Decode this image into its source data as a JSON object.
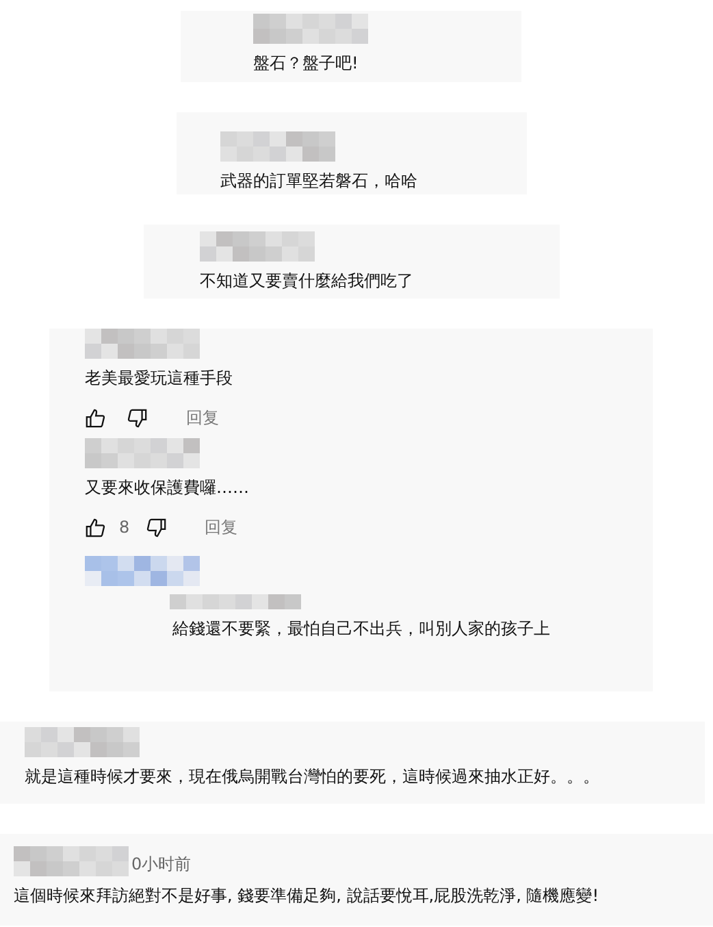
{
  "comments": [
    {
      "kind": "single",
      "text": "盤石？盤子吧!"
    },
    {
      "kind": "single",
      "text": "武器的訂單堅若磐石，哈哈"
    },
    {
      "kind": "single",
      "text": "不知道又要賣什麼給我們吃了"
    },
    {
      "kind": "thread",
      "items": [
        {
          "kind": "comment",
          "text": "老美最愛玩這種手段",
          "reply_label": "回复"
        },
        {
          "kind": "comment",
          "text": "又要來收保護費囉……",
          "likes": "8",
          "reply_label": "回复"
        },
        {
          "kind": "mention"
        },
        {
          "kind": "quote",
          "text": "給錢還不要緊，最怕自己不出兵，叫別人家的孩子上"
        }
      ]
    },
    {
      "kind": "single",
      "text": "就是這種時候才要來，現在俄烏開戰台灣怕的要死，這時候過來抽水正好。。。"
    },
    {
      "kind": "single",
      "time": "0小时前",
      "text": "這個時候來拜訪絕對不是好事, 錢要準備足夠, 說話要悅耳,屁股洗乾淨, 隨機應變!"
    }
  ]
}
